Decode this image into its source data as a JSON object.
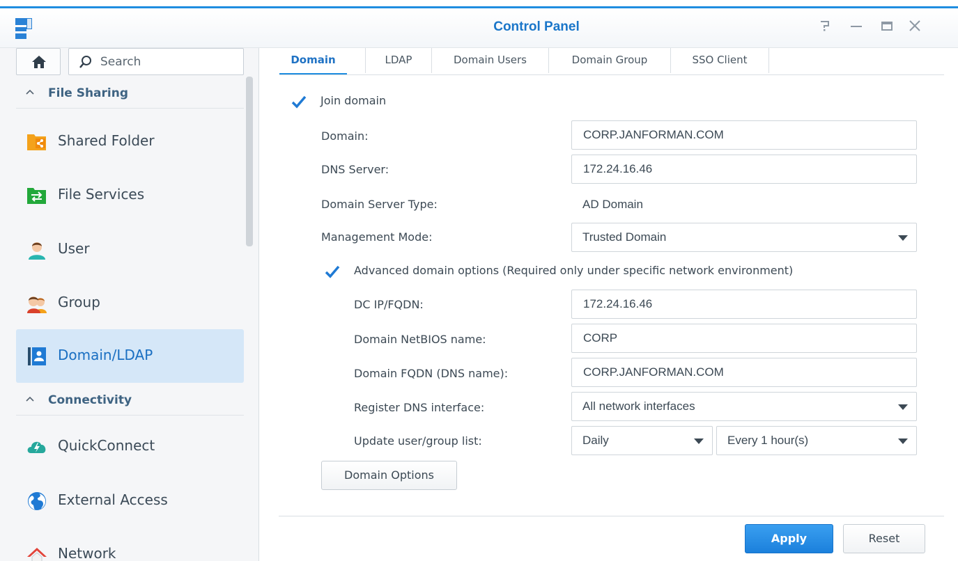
{
  "window": {
    "title": "Control Panel",
    "help_icon": "help-icon",
    "minimize_icon": "minimize-icon",
    "maximize_icon": "maximize-icon",
    "close_icon": "close-icon"
  },
  "sidebar": {
    "search_placeholder": "Search",
    "sections": [
      {
        "label": "File Sharing",
        "icon": "chevron-up-icon"
      },
      {
        "label": "Connectivity",
        "icon": "chevron-up-icon"
      }
    ],
    "items": [
      {
        "label": "Shared Folder",
        "icon": "shared-folder-icon",
        "active": false
      },
      {
        "label": "File Services",
        "icon": "file-services-icon",
        "active": false
      },
      {
        "label": "User",
        "icon": "user-icon",
        "active": false
      },
      {
        "label": "Group",
        "icon": "group-icon",
        "active": false
      },
      {
        "label": "Domain/LDAP",
        "icon": "domain-ldap-icon",
        "active": true
      },
      {
        "label": "QuickConnect",
        "icon": "quickconnect-icon",
        "active": false
      },
      {
        "label": "External Access",
        "icon": "external-access-icon",
        "active": false
      },
      {
        "label": "Network",
        "icon": "network-icon",
        "active": false
      }
    ]
  },
  "tabs": [
    {
      "label": "Domain",
      "active": true
    },
    {
      "label": "LDAP",
      "active": false
    },
    {
      "label": "Domain Users",
      "active": false
    },
    {
      "label": "Domain Group",
      "active": false
    },
    {
      "label": "SSO Client",
      "active": false
    }
  ],
  "form": {
    "join_domain": {
      "label": "Join domain",
      "checked": true
    },
    "domain": {
      "label": "Domain:",
      "value": "CORP.JANFORMAN.COM"
    },
    "dns_server": {
      "label": "DNS Server:",
      "value": "172.24.16.46"
    },
    "server_type": {
      "label": "Domain Server Type:",
      "value": "AD Domain"
    },
    "management_mode": {
      "label": "Management Mode:",
      "value": "Trusted Domain"
    },
    "advanced": {
      "label": "Advanced domain options (Required only under specific network environment)",
      "checked": true
    },
    "dc_ip": {
      "label": "DC IP/FQDN:",
      "value": "172.24.16.46"
    },
    "netbios": {
      "label": "Domain NetBIOS name:",
      "value": "CORP"
    },
    "fqdn": {
      "label": "Domain FQDN (DNS name):",
      "value": "CORP.JANFORMAN.COM"
    },
    "register_dns": {
      "label": "Register DNS interface:",
      "value": "All network interfaces"
    },
    "update_list": {
      "label": "Update user/group list:",
      "frequency": "Daily",
      "interval": "Every 1 hour(s)"
    },
    "domain_options_button": "Domain Options"
  },
  "footer": {
    "apply": "Apply",
    "reset": "Reset"
  },
  "colors": {
    "accent": "#1f8de0",
    "active_nav_bg": "#d5e7f8",
    "title_text": "#1a76c9"
  }
}
